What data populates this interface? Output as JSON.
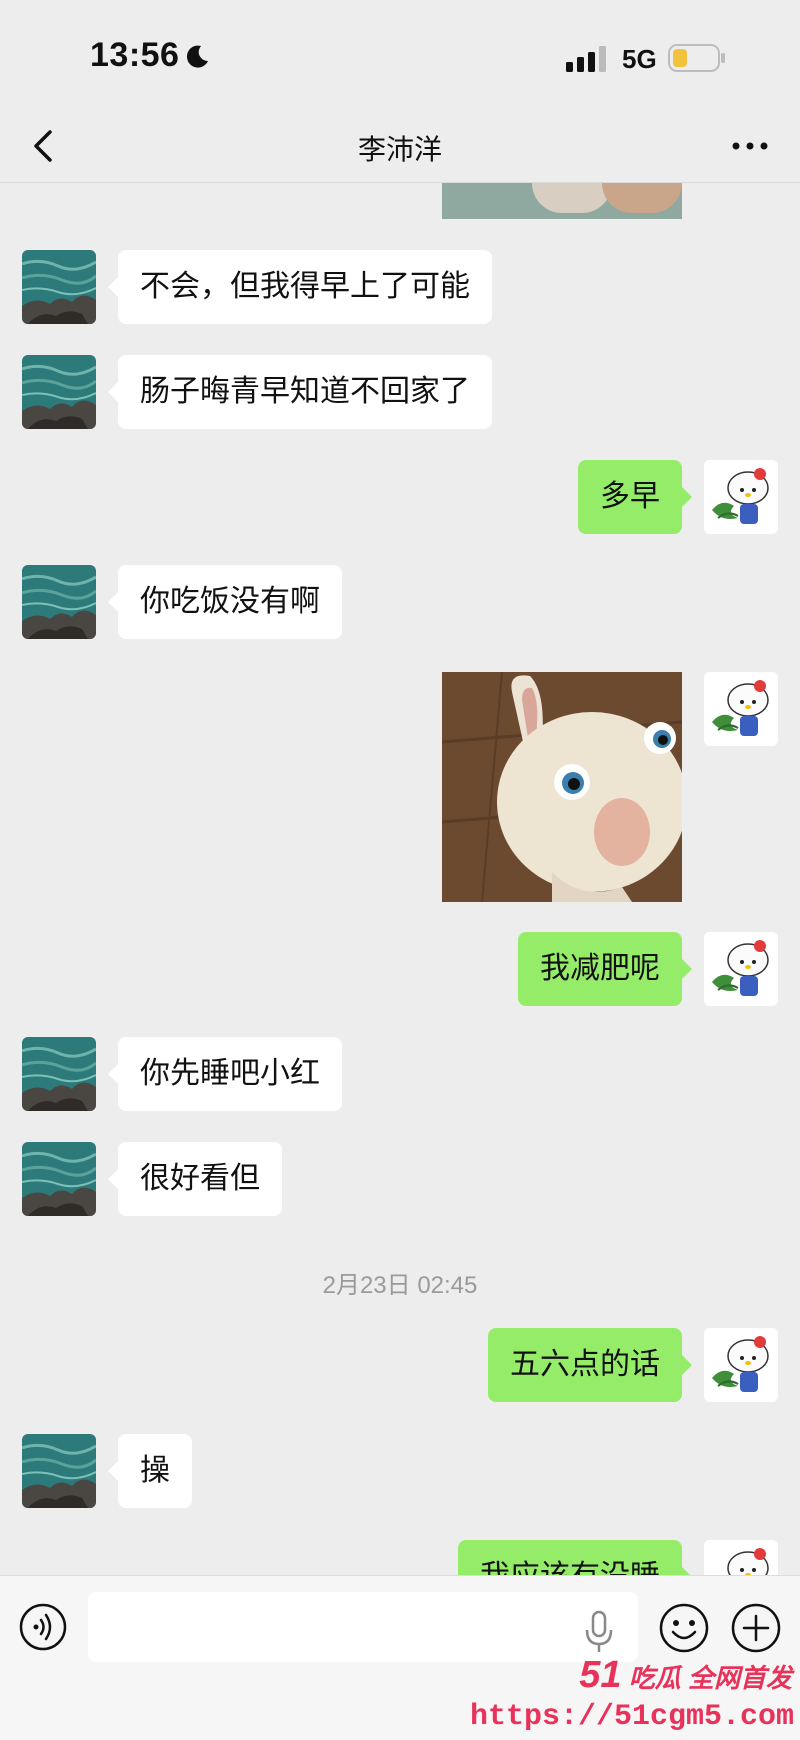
{
  "status_bar": {
    "time": "13:56",
    "network": "5G"
  },
  "header": {
    "title": "李沛洋"
  },
  "messages": [
    {
      "side": "left",
      "text": "不会，但我得早上了可能"
    },
    {
      "side": "left",
      "text": "肠子晦青早知道不回家了"
    },
    {
      "side": "right",
      "text": "多早"
    },
    {
      "side": "left",
      "text": "你吃饭没有啊"
    },
    {
      "side": "right",
      "type": "sticker",
      "icon": "rabbid-sticker"
    },
    {
      "side": "right",
      "text": "我减肥呢"
    },
    {
      "side": "left",
      "text": "你先睡吧小红"
    },
    {
      "side": "left",
      "text": "很好看但"
    },
    {
      "type": "timestamp",
      "text": "2月23日 02:45"
    },
    {
      "side": "right",
      "text": "五六点的话"
    },
    {
      "side": "left",
      "text": "操"
    },
    {
      "side": "right",
      "text": "我应该有没睡"
    }
  ],
  "input_bar": {
    "placeholder": ""
  },
  "watermark": {
    "number": "51",
    "brand": "吃瓜 全网首发",
    "url": "https://51cgm5.com"
  },
  "colors": {
    "background": "#ededed",
    "sent_bubble": "#95ec69",
    "received_bubble": "#ffffff",
    "watermark": "#e8325a"
  }
}
